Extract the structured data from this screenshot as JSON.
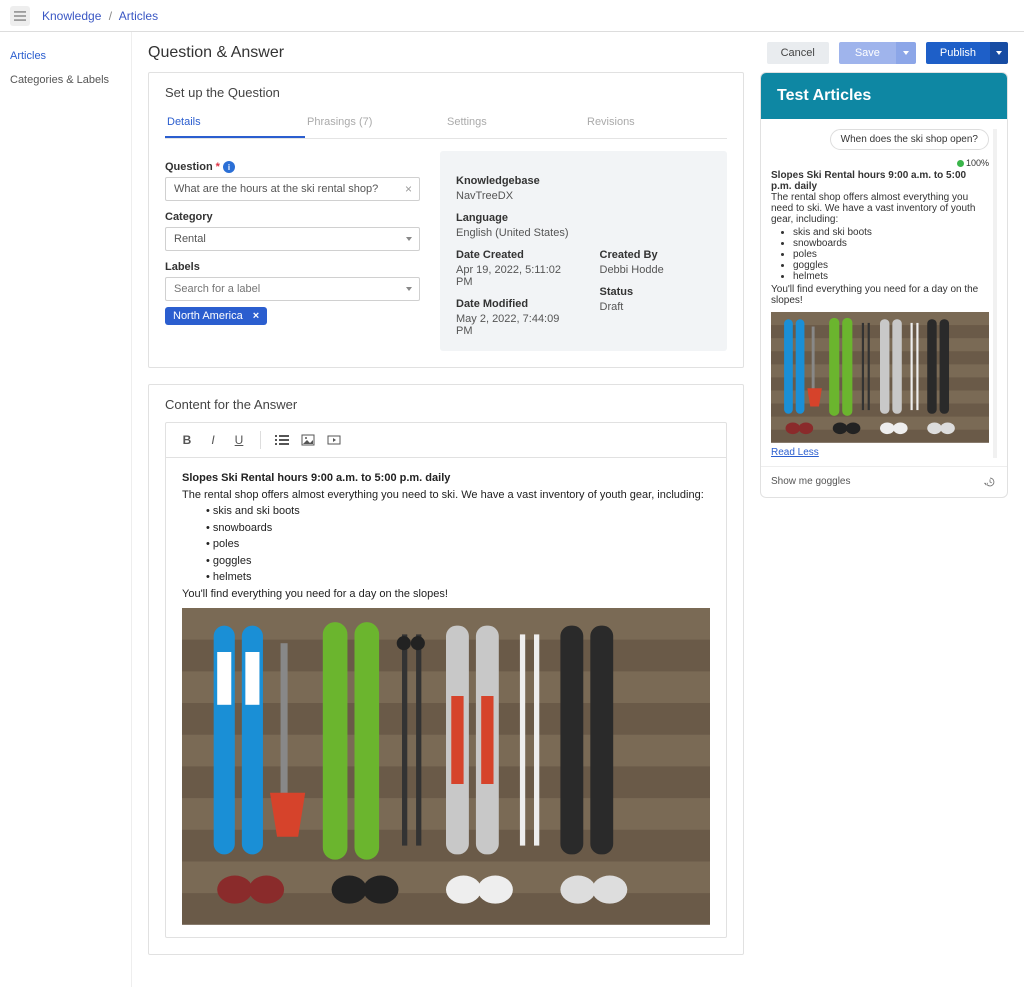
{
  "breadcrumb": {
    "root": "Knowledge",
    "current": "Articles"
  },
  "leftnav": {
    "active": "Articles",
    "item1": "Categories & Labels"
  },
  "header": {
    "title": "Question & Answer"
  },
  "buttons": {
    "cancel": "Cancel",
    "save": "Save",
    "publish": "Publish"
  },
  "setup": {
    "title": "Set up the Question",
    "tabs": {
      "details": "Details",
      "phrasings": "Phrasings (7)",
      "settings": "Settings",
      "revisions": "Revisions"
    },
    "question_label": "Question",
    "question_value": "What are the hours at the ski rental shop?",
    "category_label": "Category",
    "category_value": "Rental",
    "labels_label": "Labels",
    "labels_placeholder": "Search for a label",
    "chip": "North America"
  },
  "meta": {
    "kb_label": "Knowledgebase",
    "kb_value": "NavTreeDX",
    "lang_label": "Language",
    "lang_value": "English (United States)",
    "created_label": "Date Created",
    "created_value": "Apr 19, 2022, 5:11:02 PM",
    "modified_label": "Date Modified",
    "modified_value": "May 2, 2022, 7:44:09 PM",
    "createdby_label": "Created By",
    "createdby_value": "Debbi Hodde",
    "status_label": "Status",
    "status_value": "Draft"
  },
  "answer": {
    "title": "Content for the Answer",
    "heading": "Slopes Ski Rental hours 9:00 a.m. to 5:00 p.m. daily",
    "intro": "The rental shop offers almost everything you need to ski. We have a vast inventory of youth gear, including:",
    "items": {
      "i0": "skis and ski boots",
      "i1": "snowboards",
      "i2": "poles",
      "i3": "goggles",
      "i4": "helmets"
    },
    "outro": "You'll find everything you need for a day on the slopes!"
  },
  "test": {
    "header": "Test Articles",
    "user_q": "When does the ski shop open?",
    "confidence": "100%",
    "bot_heading": "Slopes Ski Rental hours 9:00 a.m. to 5:00 p.m. daily",
    "bot_intro": "The rental shop offers almost everything you need to ski. We have a vast inventory of youth gear, including:",
    "items": {
      "i0": "skis and ski boots",
      "i1": "snowboards",
      "i2": "poles",
      "i3": "goggles",
      "i4": "helmets"
    },
    "bot_outro": "You'll find everything you need for a day on the slopes!",
    "read_less": "Read Less",
    "input_value": "Show me goggles"
  }
}
